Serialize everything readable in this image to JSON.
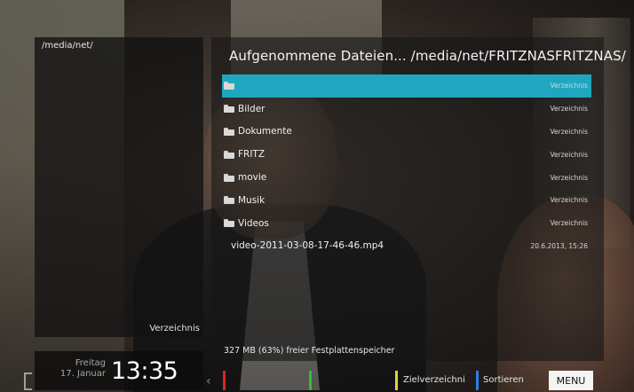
{
  "left_panel": {
    "path": "/media/net/",
    "type_label": "Verzeichnis"
  },
  "browser": {
    "title": "Aufgenommene Dateien...  /media/net/FRITZNASFRITZNAS/",
    "rows": [
      {
        "icon": "folder-up-icon",
        "name": "",
        "type": "Verzeichnis",
        "selected": true
      },
      {
        "icon": "folder-icon",
        "name": "Bilder",
        "type": "Verzeichnis"
      },
      {
        "icon": "folder-icon",
        "name": "Dokumente",
        "type": "Verzeichnis"
      },
      {
        "icon": "folder-icon",
        "name": "FRITZ",
        "type": "Verzeichnis"
      },
      {
        "icon": "folder-icon",
        "name": "movie",
        "type": "Verzeichnis"
      },
      {
        "icon": "folder-icon",
        "name": "Musik",
        "type": "Verzeichnis"
      },
      {
        "icon": "folder-icon",
        "name": "Videos",
        "type": "Verzeichnis"
      },
      {
        "icon": "",
        "name": "video-2011-03-08-17-46-46.mp4",
        "type": "20.6.2013, 15:26"
      }
    ],
    "status": "327 MB (63%) freier Festplattenspeicher"
  },
  "clock": {
    "weekday": "Freitag",
    "date": "17. Januar",
    "time": "13:35"
  },
  "buttons": {
    "red": {
      "color": "#e02424",
      "label": ""
    },
    "green": {
      "color": "#2fbf2f",
      "label": ""
    },
    "yellow": {
      "color": "#e8cf2a",
      "label": "Zielverzeichni"
    },
    "blue": {
      "color": "#2a7ee8",
      "label": "Sortieren"
    },
    "menu": "MENU"
  },
  "colors": {
    "selection": "#20a7c0"
  }
}
